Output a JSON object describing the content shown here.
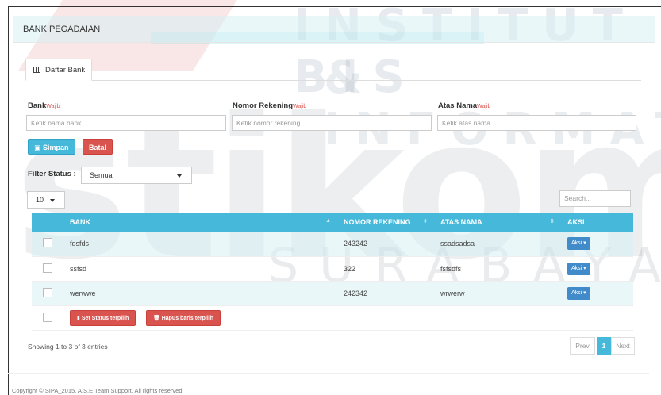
{
  "watermark": {
    "line1": "INSTITUT BIS",
    "line2": "& INFORMAT",
    "brand": "stikom",
    "city": "SURABAYA"
  },
  "panel": {
    "title": "BANK PEGADAIAN"
  },
  "tab": {
    "label": "Daftar Bank",
    "icon": "table-icon"
  },
  "form": {
    "required_tag": "Wajib",
    "bank": {
      "label": "Bank",
      "placeholder": "Ketik nama bank"
    },
    "nomor_rekening": {
      "label": "Nomor Rekening",
      "placeholder": "Ketik nomor rekening"
    },
    "atas_nama": {
      "label": "Atas Nama",
      "placeholder": "Ketik atas nama"
    },
    "save_label": "Simpan",
    "save_icon": "save-icon",
    "cancel_label": "Batal"
  },
  "filter": {
    "label": "Filter Status :",
    "value": "Semua"
  },
  "page_size": {
    "value": "10"
  },
  "search": {
    "placeholder": "Search..."
  },
  "table": {
    "columns": [
      "BANK",
      "NOMOR REKENING",
      "ATAS NAMA",
      "AKSI"
    ],
    "rows": [
      {
        "bank": "fdsfds",
        "nomor": "243242",
        "atas_nama": "ssadsadsa",
        "aksi": "Aksi"
      },
      {
        "bank": "ssfsd",
        "nomor": "322",
        "atas_nama": "fsfsdfs",
        "aksi": "Aksi"
      },
      {
        "bank": "werwwe",
        "nomor": "242342",
        "atas_nama": "wrwerw",
        "aksi": "Aksi"
      }
    ],
    "bulk_set_status": "Set Status terpilih",
    "bulk_delete": "Hapus baris terpilih"
  },
  "info": "Showing 1 to 3 of 3 entries",
  "pagination": {
    "prev": "Prev",
    "current": "1",
    "next": "Next"
  },
  "footer": "Copyright © SIPA_2015. A.S.E Team Support. All rights reserved.",
  "colors": {
    "accent": "#46b8da",
    "danger": "#d9534f",
    "primary": "#428bca"
  }
}
